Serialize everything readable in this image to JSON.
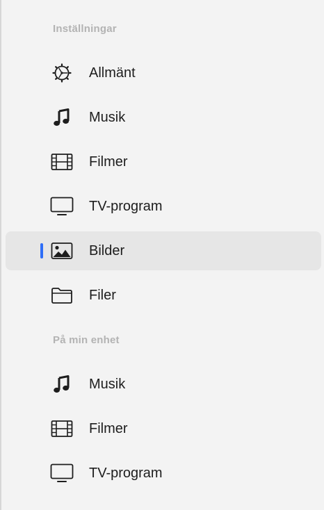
{
  "sidebar": {
    "sections": [
      {
        "header": "Inställningar",
        "items": [
          {
            "label": "Allmänt",
            "icon": "gear-icon"
          },
          {
            "label": "Musik",
            "icon": "music-note-icon"
          },
          {
            "label": "Filmer",
            "icon": "film-icon"
          },
          {
            "label": "TV-program",
            "icon": "tv-icon"
          },
          {
            "label": "Bilder",
            "icon": "photo-icon",
            "selected": true
          },
          {
            "label": "Filer",
            "icon": "folder-icon"
          }
        ]
      },
      {
        "header": "På min enhet",
        "items": [
          {
            "label": "Musik",
            "icon": "music-note-icon"
          },
          {
            "label": "Filmer",
            "icon": "film-icon"
          },
          {
            "label": "TV-program",
            "icon": "tv-icon"
          }
        ]
      }
    ],
    "colors": {
      "background": "#f3f3f3",
      "selected_background": "#e6e6e6",
      "accent": "#2f6ef7",
      "header_text": "#b3b3b3",
      "item_text": "#1d1d1d"
    }
  }
}
